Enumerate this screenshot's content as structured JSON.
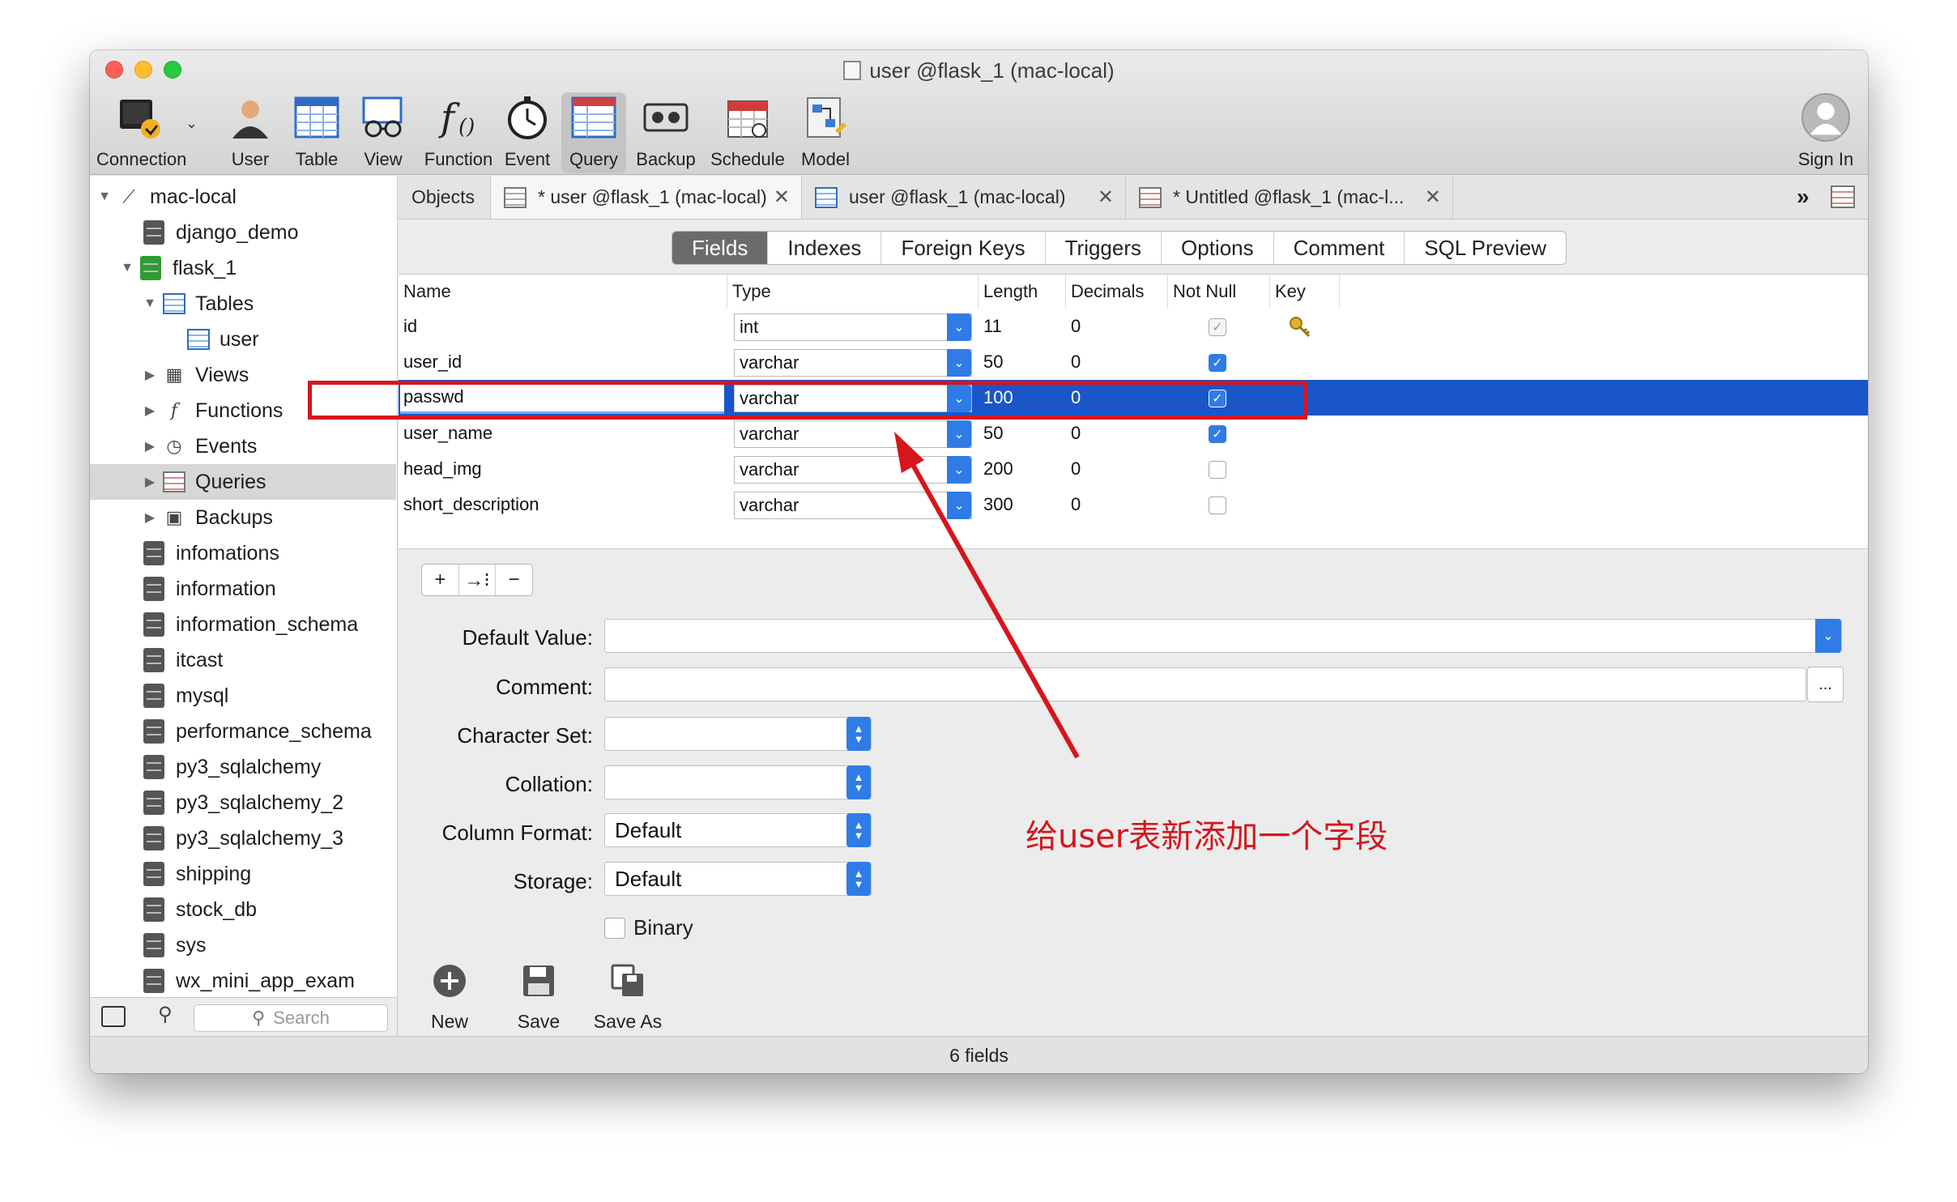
{
  "window": {
    "title": "user @flask_1 (mac-local)"
  },
  "toolbar": {
    "items": [
      {
        "label": "Connection",
        "icon": "connection-icon"
      },
      {
        "label": "User",
        "icon": "user-icon"
      },
      {
        "label": "Table",
        "icon": "table-icon"
      },
      {
        "label": "View",
        "icon": "view-icon"
      },
      {
        "label": "Function",
        "icon": "function-icon"
      },
      {
        "label": "Event",
        "icon": "event-icon"
      },
      {
        "label": "Query",
        "icon": "query-icon"
      },
      {
        "label": "Backup",
        "icon": "backup-icon"
      },
      {
        "label": "Schedule",
        "icon": "schedule-icon"
      },
      {
        "label": "Model",
        "icon": "model-icon"
      }
    ],
    "active": "Query",
    "sign_in": "Sign In"
  },
  "sidebar": {
    "connection": "mac-local",
    "items": [
      "django_demo",
      "flask_1",
      "Tables",
      "user",
      "Views",
      "Functions",
      "Events",
      "Queries",
      "Backups",
      "infomations",
      "information",
      "information_schema",
      "itcast",
      "mysql",
      "performance_schema",
      "py3_sqlalchemy",
      "py3_sqlalchemy_2",
      "py3_sqlalchemy_3",
      "shipping",
      "stock_db",
      "sys",
      "wx_mini_app_exam"
    ],
    "selected": "Queries",
    "search_placeholder": "Search"
  },
  "tabs": {
    "objects": "Objects",
    "items": [
      {
        "label": "* user @flask_1 (mac-local)",
        "closable": true
      },
      {
        "label": "user @flask_1 (mac-local)",
        "closable": true
      },
      {
        "label": "* Untitled @flask_1 (mac-l...",
        "closable": true
      }
    ]
  },
  "subtabs": {
    "items": [
      "Fields",
      "Indexes",
      "Foreign Keys",
      "Triggers",
      "Options",
      "Comment",
      "SQL Preview"
    ],
    "active": "Fields"
  },
  "fields_table": {
    "columns": [
      "Name",
      "Type",
      "Length",
      "Decimals",
      "Not Null",
      "Key"
    ],
    "rows": [
      {
        "name": "id",
        "type": "int",
        "length": "11",
        "decimals": "0",
        "not_null": true,
        "key": true
      },
      {
        "name": "user_id",
        "type": "varchar",
        "length": "50",
        "decimals": "0",
        "not_null": true,
        "key": false
      },
      {
        "name": "passwd",
        "type": "varchar",
        "length": "100",
        "decimals": "0",
        "not_null": true,
        "key": false
      },
      {
        "name": "user_name",
        "type": "varchar",
        "length": "50",
        "decimals": "0",
        "not_null": true,
        "key": false
      },
      {
        "name": "head_img",
        "type": "varchar",
        "length": "200",
        "decimals": "0",
        "not_null": false,
        "key": false
      },
      {
        "name": "short_description",
        "type": "varchar",
        "length": "300",
        "decimals": "0",
        "not_null": false,
        "key": false
      }
    ],
    "selected_row": "passwd"
  },
  "row_buttons": {
    "add": "+",
    "insert": "→⁝",
    "remove": "−"
  },
  "properties": {
    "default_value_label": "Default Value:",
    "default_value": "",
    "comment_label": "Comment:",
    "comment": "",
    "comment_more": "...",
    "character_set_label": "Character Set:",
    "character_set": "",
    "collation_label": "Collation:",
    "collation": "",
    "column_format_label": "Column Format:",
    "column_format": "Default",
    "storage_label": "Storage:",
    "storage": "Default",
    "binary_label": "Binary",
    "binary": false
  },
  "bottom_toolbar": {
    "new": "New",
    "save": "Save",
    "save_as": "Save As"
  },
  "status": "6 fields",
  "annotation": {
    "text": "给user表新添加一个字段",
    "color": "#d5161d"
  },
  "colors": {
    "selection": "#1a55c9",
    "accent": "#2f7ce6",
    "annotation": "#d5161d"
  }
}
